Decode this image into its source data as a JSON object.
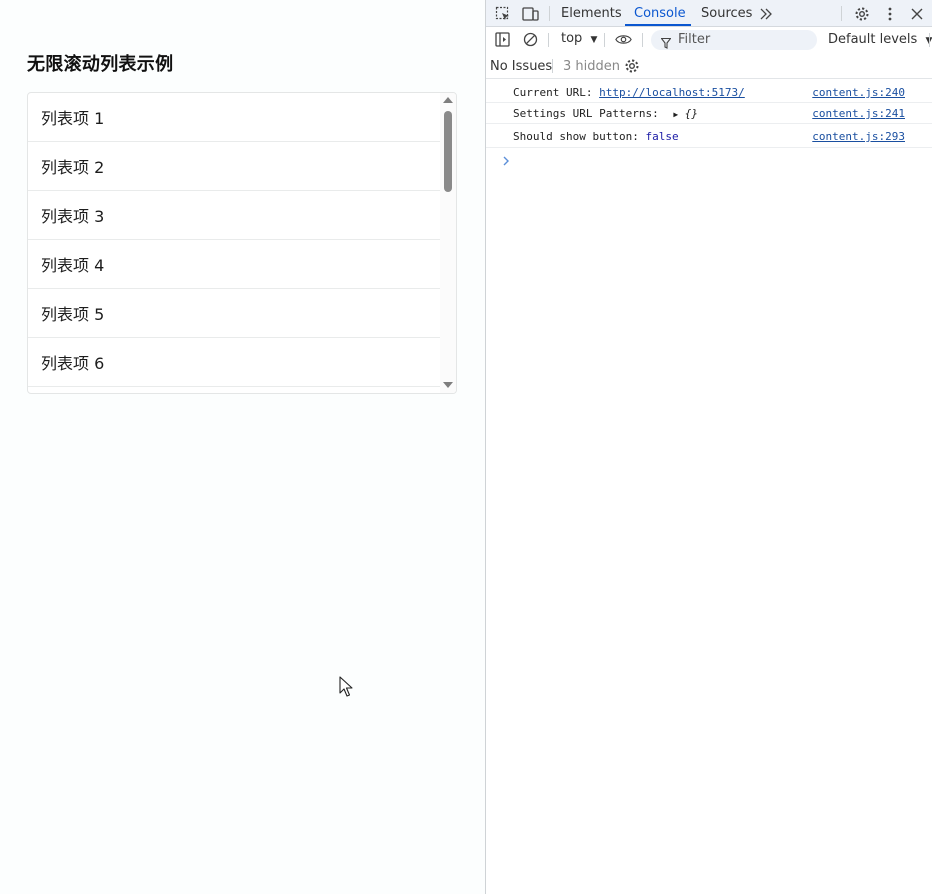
{
  "page": {
    "title": "无限滚动列表示例",
    "items": [
      "列表项 1",
      "列表项 2",
      "列表项 3",
      "列表项 4",
      "列表项 5",
      "列表项 6"
    ]
  },
  "devtools": {
    "tabs": {
      "elements": "Elements",
      "console": "Console",
      "sources": "Sources"
    },
    "toolbar": {
      "context": "top",
      "filter_placeholder": "Filter",
      "levels": "Default levels"
    },
    "issues": {
      "no_issues": "No Issues",
      "hidden": "3 hidden"
    },
    "logs": [
      {
        "prefix": "Current URL: ",
        "value": "http://localhost:5173/",
        "source": "content.js:240"
      },
      {
        "prefix": "Settings URL Patterns: ",
        "value": "{}",
        "source": "content.js:241"
      },
      {
        "prefix": "Should show button: ",
        "value": "false",
        "source": "content.js:293"
      }
    ]
  }
}
